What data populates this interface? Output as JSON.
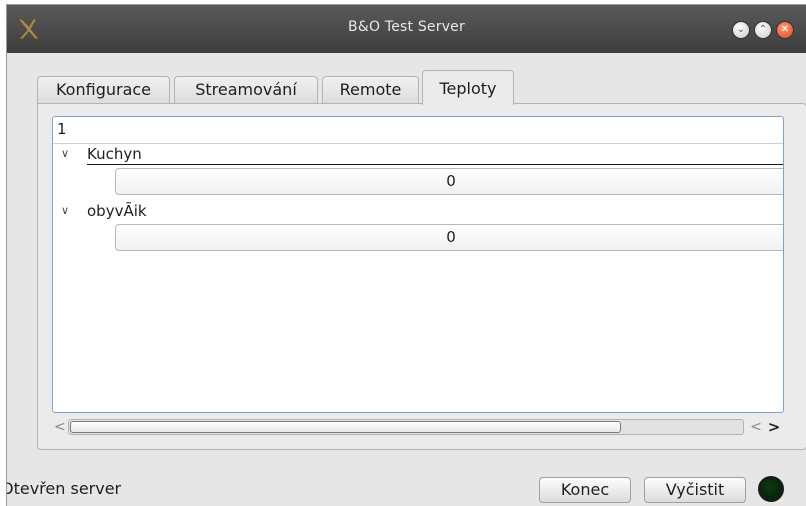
{
  "window": {
    "title": "B&O Test Server"
  },
  "titlebar_buttons": {
    "minimize_icon": "minimize-icon",
    "maximize_icon": "maximize-icon",
    "close_icon": "close-icon"
  },
  "tabs": [
    {
      "label": "Konfigurace",
      "active": false
    },
    {
      "label": "Streamování",
      "active": false
    },
    {
      "label": "Remote",
      "active": false
    },
    {
      "label": "Teploty",
      "active": true
    }
  ],
  "tree": {
    "header": "1",
    "groups": [
      {
        "label": "Kuchyn",
        "value": "0"
      },
      {
        "label": "obyvÃik",
        "value": "0"
      }
    ],
    "scrollbar": {
      "thumb_fraction": 0.82
    }
  },
  "status": {
    "text": "Otevřen server",
    "led_color": "#063310"
  },
  "buttons": {
    "konec": "Konec",
    "vycistit": "Vyčistit"
  }
}
